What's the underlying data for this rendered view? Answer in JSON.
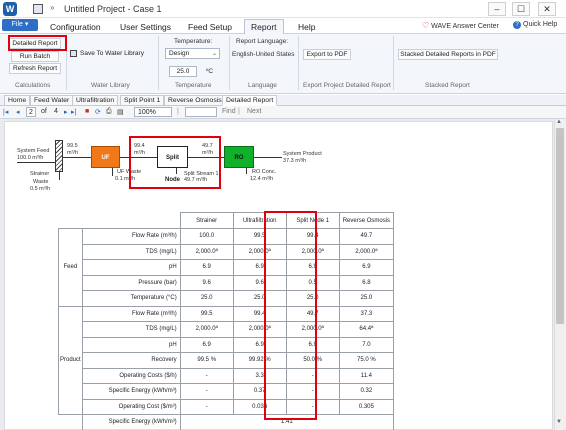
{
  "window": {
    "logo_text": "W",
    "title": "Untitled Project - Case 1",
    "qa_arrow": "»",
    "controls": [
      "–",
      "☐",
      "✕"
    ]
  },
  "ribbon": {
    "file_label": "File ▾",
    "tabs": [
      "Configuration",
      "User Settings",
      "Feed Setup",
      "Report",
      "Help"
    ],
    "active_tab": "Report",
    "wave_center": "WAVE Answer Center",
    "quick_help": "Quick Help",
    "calculations": {
      "detailed_report": "Detailed Report",
      "run_batch": "Run Batch",
      "refresh_report": "Refresh Report",
      "group_label": "Calculations"
    },
    "water_library": {
      "save_label": "Save To Water Library",
      "group_label": "Water Library"
    },
    "temperature": {
      "title": "Temperature:",
      "mode": "Design",
      "value": "25.0",
      "unit": "ºC",
      "group_label": "Temperature"
    },
    "language": {
      "title": "Report Language:",
      "value": "English-United States",
      "group_label": "Language"
    },
    "export": {
      "export_pdf": "Export to PDF",
      "group_label": "Export Project Detailed Report"
    },
    "stacked": {
      "button": "Stacked Detailed Reports in PDF",
      "group_label": "Stacked Report"
    }
  },
  "doc_tabs": [
    "Home",
    "Feed Water",
    "Ultrafiltration",
    "Split Point 1",
    "Reverse Osmosis",
    "Detailed Report"
  ],
  "active_doc_tab": "Detailed Report",
  "report_toolbar": {
    "first": "|◂",
    "prev": "◂",
    "page": "2",
    "of": "of",
    "total": "4",
    "next": "▸",
    "last": "▸|",
    "stop": "■",
    "refresh": "⟳",
    "print": "⎙",
    "layout": "▤",
    "zoom": "100%",
    "find": "Find",
    "next_find": "Next",
    "sep": "|"
  },
  "flow": {
    "system_feed_label": "System Feed",
    "system_feed_value": "100.0 m³/h",
    "strainer_out": "99.5",
    "strainer_out_unit": "m³/h",
    "strainer_label": "Strainer",
    "waste_label": "Waste",
    "waste_value": "0.5 m³/h",
    "uf_label": "UF",
    "uf_waste": "UF Waste",
    "uf_waste_value": "0.1 m³/h",
    "uf_out": "99.4",
    "uf_out_unit": "m³/h",
    "split_label": "Split Node",
    "split_stream": "Split Stream 1",
    "split_stream_value": "49.7 m³/h",
    "split_out": "49.7",
    "split_out_unit": "m³/h",
    "ro_label": "RO",
    "ro_conc": "RO Conc.",
    "ro_conc_value": "12.4 m³/h",
    "system_product": "System Product",
    "system_product_value": "37.3 m³/h"
  },
  "table": {
    "headers": [
      "Strainer",
      "Ultrafiltration",
      "Split Node 1",
      "Reverse Osmosis"
    ],
    "groups": {
      "feed": "Feed",
      "product": "Product"
    },
    "rows": [
      {
        "label": "Flow Rate (m³/h)",
        "values": [
          "100.0",
          "99.5",
          "99.4",
          "49.7"
        ]
      },
      {
        "label": "TDS (mg/L)",
        "values": [
          "2,000.0ª",
          "2,000.0ª",
          "2,000.0ª",
          "2,000.0ª"
        ]
      },
      {
        "label": "pH",
        "values": [
          "6.9",
          "6.9",
          "6.9",
          "6.9"
        ]
      },
      {
        "label": "Pressure (bar)",
        "values": [
          "9.6",
          "9.6",
          "0.5",
          "6.8"
        ]
      },
      {
        "label": "Temperature (°C)",
        "values": [
          "25.0",
          "25.0",
          "25.0",
          "25.0"
        ]
      },
      {
        "label": "Flow Rate (m³/h)",
        "values": [
          "99.5",
          "99.4",
          "49.7",
          "37.3"
        ]
      },
      {
        "label": "TDS (mg/L)",
        "values": [
          "2,000.0ª",
          "2,000.0ª",
          "2,000.0ª",
          "64.4ª"
        ]
      },
      {
        "label": "pH",
        "values": [
          "6.9",
          "6.9",
          "6.9",
          "7.0"
        ]
      },
      {
        "label": "Recovery",
        "values": [
          "99.5 %",
          "99.92 %",
          "50.0 %",
          "75.0 %"
        ]
      },
      {
        "label": "Operating Costs ($/h)",
        "values": [
          "-",
          "3.3",
          "-",
          "11.4"
        ]
      },
      {
        "label": "Specific Energy (kWh/m³)",
        "values": [
          "-",
          "0.37",
          "-",
          "0.32"
        ]
      },
      {
        "label": "Operating Cost ($/m³)",
        "values": [
          "-",
          "0.034",
          "-",
          "0.305"
        ]
      }
    ],
    "footer_label": "Specific Energy (kWh/m³)",
    "footer_value": "1.41"
  },
  "scroll": {
    "up": "▲",
    "down": "▼"
  },
  "colors": {
    "highlight": "#e00010",
    "uf": "#f07818",
    "ro": "#10b02a"
  }
}
